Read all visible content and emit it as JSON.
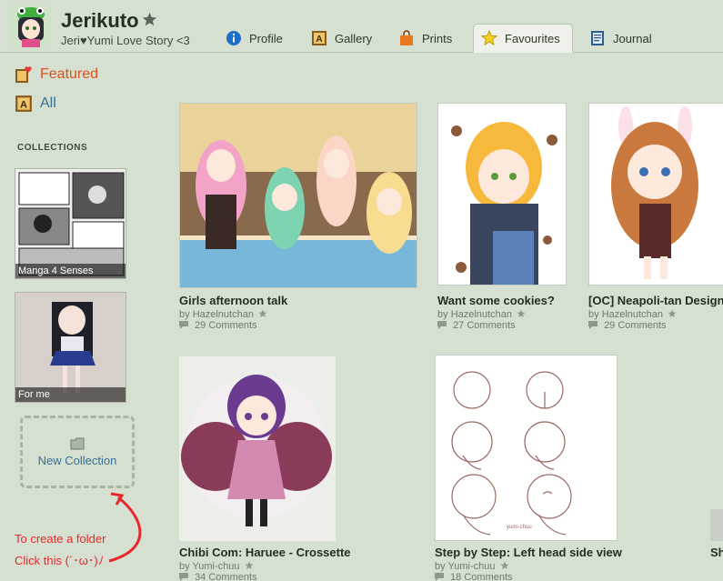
{
  "header": {
    "username": "Jerikuto",
    "tagline": "Jeri♥Yumi Love Story <3",
    "tabs": [
      {
        "label": "Profile",
        "icon": "info-icon"
      },
      {
        "label": "Gallery",
        "icon": "gallery-icon"
      },
      {
        "label": "Prints",
        "icon": "prints-bag-icon"
      },
      {
        "label": "Favourites",
        "icon": "star-icon",
        "active": true
      },
      {
        "label": "Journal",
        "icon": "journal-icon"
      }
    ]
  },
  "sidebar": {
    "featured_label": "Featured",
    "all_label": "All",
    "collections_heading": "COLLECTIONS",
    "collections": [
      {
        "label": "Manga 4 Senses"
      },
      {
        "label": "For me"
      }
    ],
    "new_collection_label": "New Collection",
    "hint_line1": "To create a folder",
    "hint_line2": "Click this (´･ω･)ﾉ"
  },
  "deviations": [
    {
      "title": "Girls afternoon talk",
      "by": "by",
      "author": "Hazelnutchan",
      "comments": "29 Comments"
    },
    {
      "title": "Want some cookies?",
      "by": "by",
      "author": "Hazelnutchan",
      "comments": "27 Comments"
    },
    {
      "title": "[OC] Neapoli-tan Design",
      "by": "by",
      "author": "Hazelnutchan",
      "comments": "29 Comments"
    },
    {
      "title": "Chibi Com: Haruee - Crossette",
      "by": "by",
      "author": "Yumi-chuu",
      "comments": "34 Comments"
    },
    {
      "title": "Step by Step: Left head side view",
      "by": "by",
      "author": "Yumi-chuu",
      "comments": "18 Comments"
    },
    {
      "title": "Sh",
      "by": "",
      "author": "",
      "comments": ""
    }
  ],
  "colors": {
    "background": "#d6e0d0",
    "featured": "#d9531e",
    "link": "#3a6e93",
    "hint": "#e8262e"
  }
}
